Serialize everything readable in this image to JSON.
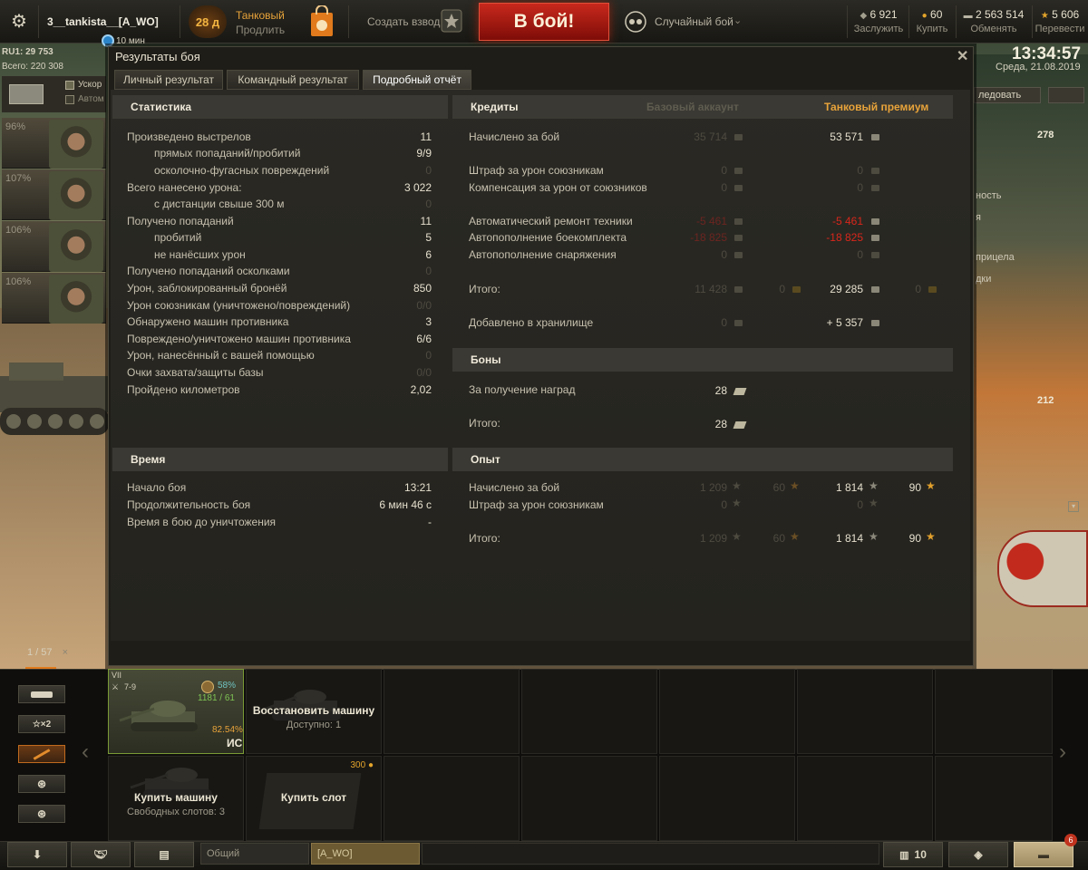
{
  "header": {
    "nickname": "3__tankista__[A_WO]",
    "premium_days": "28 д",
    "premium_label": "Танковый",
    "premium_action": "Продлить",
    "platoon": "Создать взвод",
    "battle_button": "В бой!",
    "battle_mode": "Случайный бой",
    "timer": "10 мин",
    "currencies": [
      {
        "value": "6 921",
        "label": "Заслужить",
        "icon": "bond-icon"
      },
      {
        "value": "60",
        "label": "Купить",
        "icon": "gold-icon"
      },
      {
        "value": "2 563 514",
        "label": "Обменять",
        "icon": "credits-icon"
      },
      {
        "value": "5 606",
        "label": "Перевести",
        "icon": "free-xp-icon"
      }
    ],
    "clock": "13:34:57",
    "date": "Среда, 21.08.2019"
  },
  "side": {
    "region_tag": "RU1: 29 753",
    "region_total": "Всего: 220 308",
    "crew": [
      "96%",
      "107%",
      "106%",
      "106%"
    ],
    "skill_labels": [
      "Ускор",
      "Автом"
    ]
  },
  "right_bits": {
    "research": "ледовать",
    "num1": "278",
    "num2": "212",
    "text1": "ность",
    "text2": "я",
    "text3": "прицела",
    "text4": "дки"
  },
  "window": {
    "title": "Результаты боя",
    "tabs": [
      "Личный результат",
      "Командный результат",
      "Подробный отчёт"
    ],
    "active_tab": 2
  },
  "stats": {
    "title": "Статистика",
    "rows": [
      {
        "label": "Произведено выстрелов",
        "value": "11",
        "indent": false,
        "dim": false
      },
      {
        "label": "прямых попаданий/пробитий",
        "value": "9/9",
        "indent": true,
        "dim": false
      },
      {
        "label": "осколочно-фугасных повреждений",
        "value": "0",
        "indent": true,
        "dim": true
      },
      {
        "label": "Всего нанесено урона:",
        "value": "3 022",
        "indent": false,
        "dim": false
      },
      {
        "label": "с дистанции свыше 300 м",
        "value": "0",
        "indent": true,
        "dim": true
      },
      {
        "label": "Получено попаданий",
        "value": "11",
        "indent": false,
        "dim": false
      },
      {
        "label": "пробитий",
        "value": "5",
        "indent": true,
        "dim": false
      },
      {
        "label": "не нанёсших урон",
        "value": "6",
        "indent": true,
        "dim": false
      },
      {
        "label": "Получено попаданий осколками",
        "value": "0",
        "indent": false,
        "dim": true
      },
      {
        "label": "Урон, заблокированный бронёй",
        "value": "850",
        "indent": false,
        "dim": false
      },
      {
        "label": "Урон союзникам (уничтожено/повреждений)",
        "value": "0/0",
        "indent": false,
        "dim": true
      },
      {
        "label": "Обнаружено машин противника",
        "value": "3",
        "indent": false,
        "dim": false
      },
      {
        "label": "Повреждено/уничтожено машин противника",
        "value": "6/6",
        "indent": false,
        "dim": false
      },
      {
        "label": "Урон, нанесённый с вашей помощью",
        "value": "0",
        "indent": false,
        "dim": true
      },
      {
        "label": "Очки захвата/защиты базы",
        "value": "0/0",
        "indent": false,
        "dim": true
      },
      {
        "label": "Пройдено километров",
        "value": "2,02",
        "indent": false,
        "dim": false
      }
    ]
  },
  "time": {
    "title": "Время",
    "rows": [
      {
        "label": "Начало боя",
        "value": "13:21"
      },
      {
        "label": "Продолжительность боя",
        "value": "6 мин 46 с"
      },
      {
        "label": "Время в бою до уничтожения",
        "value": "-"
      }
    ]
  },
  "credits": {
    "title": "Кредиты",
    "col_basic": "Базовый аккаунт",
    "col_premium": "Танковый премиум",
    "earned_label": "Начислено за бой",
    "earned_basic": "35 714",
    "earned_prem": "53 571",
    "ally_fine_label": "Штраф за урон союзникам",
    "ally_fine_basic": "0",
    "ally_fine_prem": "0",
    "ally_comp_label": "Компенсация за урон от союзников",
    "ally_comp_basic": "0",
    "ally_comp_prem": "0",
    "repair_label": "Автоматический ремонт техники",
    "repair_basic": "-5 461",
    "repair_prem": "-5 461",
    "ammo_label": "Автопополнение боекомплекта",
    "ammo_basic": "-18 825",
    "ammo_prem": "-18 825",
    "equip_label": "Автопополнение снаряжения",
    "equip_basic": "0",
    "equip_prem": "0",
    "total_label": "Итого:",
    "total_basic": "11 428",
    "total_basic_gold": "0",
    "total_prem": "29 285",
    "total_prem_gold": "0",
    "stored_label": "Добавлено в хранилище",
    "stored_basic": "0",
    "stored_prem": "+ 5 357"
  },
  "bonds": {
    "title": "Боны",
    "awards_label": "За получение наград",
    "awards_value": "28",
    "total_label": "Итого:",
    "total_value": "28"
  },
  "xp": {
    "title": "Опыт",
    "earned_label": "Начислено за бой",
    "earned_basic": "1 209",
    "earned_basic_free": "60",
    "earned_prem": "1 814",
    "earned_prem_free": "90",
    "fine_label": "Штраф за урон союзникам",
    "fine_basic": "0",
    "fine_prem": "0",
    "total_label": "Итого:",
    "total_basic": "1 209",
    "total_basic_free": "60",
    "total_prem": "1 814",
    "total_prem_free": "90"
  },
  "carousel": {
    "count": "1 / 57",
    "close": "×",
    "filter_x2": "×2",
    "tank": {
      "tier": "VII",
      "battles": "7-9",
      "winrate": "58%",
      "stats": "1181 / 61",
      "mastery": "82.54%",
      "name": "ИС"
    },
    "restore_title": "Восстановить машину",
    "restore_sub": "Доступно: 1",
    "buy_tank_title": "Купить машину",
    "buy_tank_sub": "Свободных слотов: 3",
    "buy_slot_title": "Купить слот",
    "buy_slot_price": "300"
  },
  "footer": {
    "channel_common": "Общий",
    "channel_clan": "[A_WO]",
    "sessions": "10",
    "notif_count": "6"
  },
  "colors": {
    "accent_gold": "#e8a33a",
    "battle_red": "#b0221a",
    "negative": "#d8271b"
  }
}
